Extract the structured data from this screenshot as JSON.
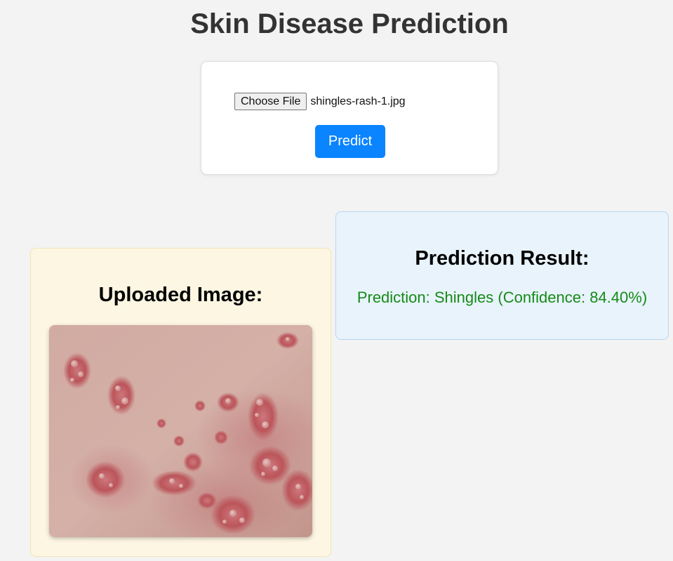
{
  "page": {
    "title": "Skin Disease Prediction"
  },
  "upload": {
    "choose_file_label": "Choose File",
    "file_name": "shingles-rash-1.jpg",
    "predict_label": "Predict"
  },
  "result": {
    "heading": "Prediction Result:",
    "text": "Prediction: Shingles (Confidence: 84.40%)",
    "text_color": "#168a16"
  },
  "image_panel": {
    "heading": "Uploaded Image:"
  },
  "colors": {
    "background": "#f3f3f3",
    "predict_button": "#0a84ff",
    "result_panel": "#e8f3fc",
    "image_panel": "#fdf6e2"
  }
}
